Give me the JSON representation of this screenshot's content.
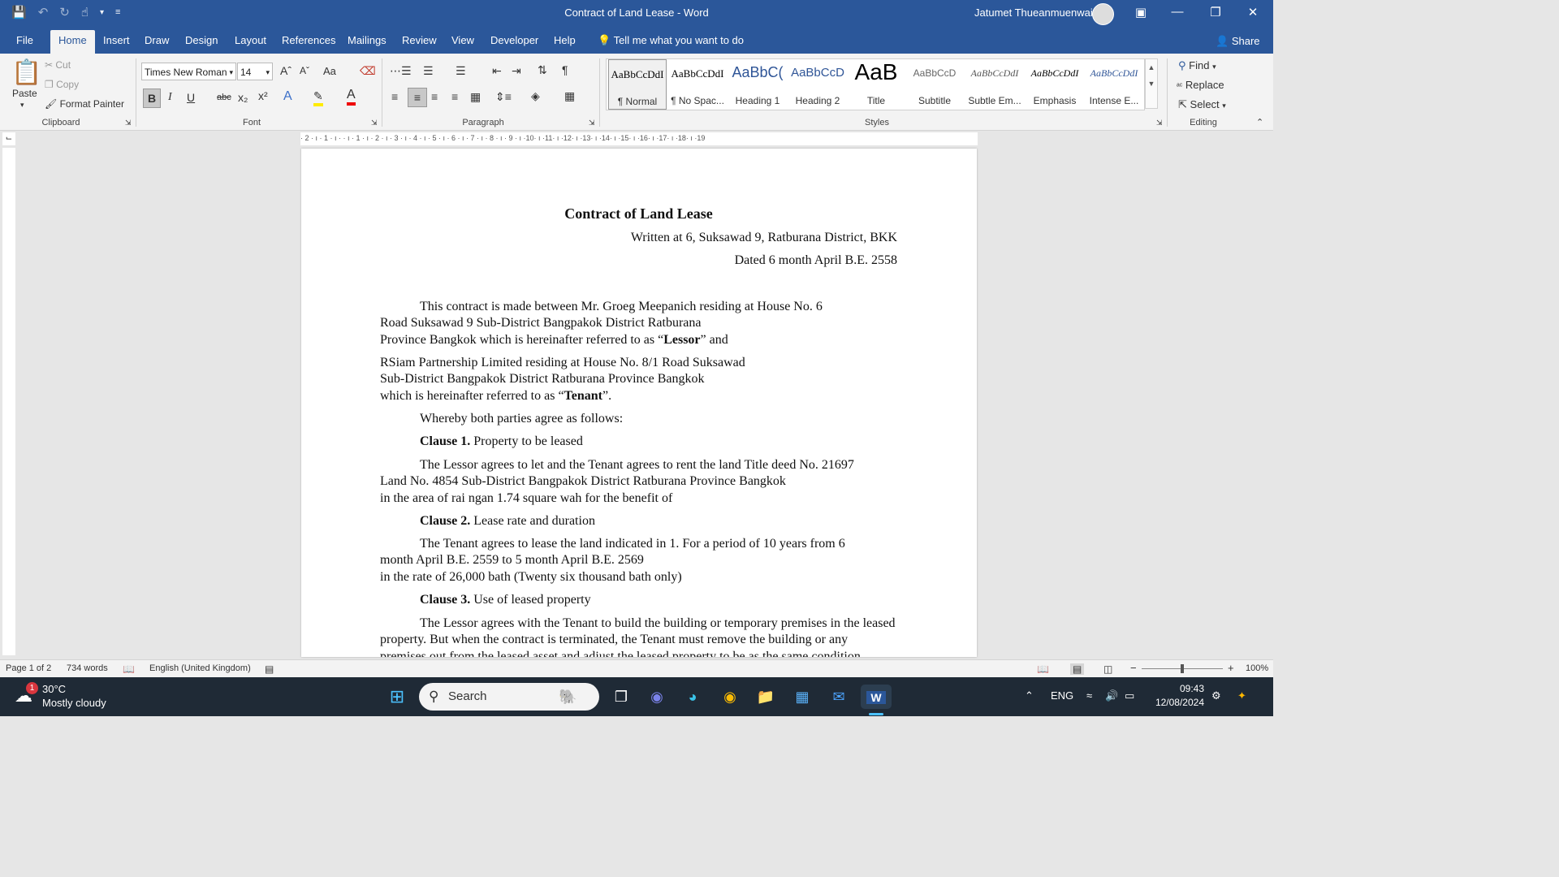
{
  "titlebar": {
    "title": "Contract of Land Lease  -  Word",
    "user": "Jatumet Thueanmuenwai",
    "qat": [
      "save-icon",
      "undo-icon",
      "redo-icon",
      "touch-mode-icon",
      "customize-icon"
    ]
  },
  "menu": {
    "file": "File",
    "tabs": [
      "Home",
      "Insert",
      "Draw",
      "Design",
      "Layout",
      "References",
      "Mailings",
      "Review",
      "View",
      "Developer",
      "Help"
    ],
    "tellme": "Tell me what you want to do",
    "share": "Share"
  },
  "ribbon": {
    "clipboard": {
      "label": "Clipboard",
      "paste": "Paste",
      "cut": "Cut",
      "copy": "Copy",
      "format_painter": "Format Painter"
    },
    "font": {
      "label": "Font",
      "name": "Times New Roman",
      "size": "14",
      "change_case": "Aa",
      "strike": "abc"
    },
    "paragraph": {
      "label": "Paragraph"
    },
    "styles": {
      "label": "Styles",
      "items": [
        {
          "sample": "AaBbCcDdI",
          "name": "¶ Normal"
        },
        {
          "sample": "AaBbCcDdI",
          "name": "¶ No Spac..."
        },
        {
          "sample": "AaBbC(",
          "name": "Heading 1"
        },
        {
          "sample": "AaBbCcD",
          "name": "Heading 2"
        },
        {
          "sample": "AaB",
          "name": "Title"
        },
        {
          "sample": "AaBbCcD",
          "name": "Subtitle"
        },
        {
          "sample": "AaBbCcDdI",
          "name": "Subtle Em..."
        },
        {
          "sample": "AaBbCcDdI",
          "name": "Emphasis"
        },
        {
          "sample": "AaBbCcDdI",
          "name": "Intense E..."
        }
      ]
    },
    "editing": {
      "label": "Editing",
      "find": "Find",
      "replace": "Replace",
      "select": "Select"
    }
  },
  "ruler": "· 2 · ı · 1 · ı ·   · ı · 1 · ı · 2 · ı · 3 · ı · 4 · ı · 5 · ı · 6 · ı · 7 · ı · 8 · ı · 9 · ı ·10· ı ·11· ı ·12· ı ·13· ı ·14· ı ·15· ı ·16· ı ·17· ı ·18· ı ·19",
  "document": {
    "title": "Contract of Land Lease",
    "written_at": "Written at 6, Suksawad 9, Ratburana District, BKK",
    "dated": "Dated  6   month   April         B.E. 2558",
    "p1_l1": "This contract is made between     Mr. Groeg  Meepanich        residing at House No.  6",
    "p1_l2": "Road   Suksawad 9    Sub-District    Bangpakok                 District            Ratburana",
    "p1_l3": "Province          Bangkok          which is hereinafter referred to as “",
    "p1_l3b": "Lessor",
    "p1_l3c": "” and",
    "p2_l1": "RSiam Partnership Limited                 residing at House No.  8/1                 Road  Suksawad",
    "p2_l2": "Sub-District    Bangpakok     District             Ratburana       Province          Bangkok",
    "p2_l3": "which is hereinafter referred to as “",
    "p2_l3b": "Tenant",
    "p2_l3c": "”.",
    "whereby": "Whereby both parties agree as follows:",
    "clause1_b": "Clause 1.",
    "clause1_t": "  Property to be leased",
    "c1_l1": "The Lessor agrees to let and the Tenant agrees to rent the land Title deed No. 21697",
    "c1_l2": "Land No. 4854     Sub-District   Bangpakok  District    Ratburana   Province          Bangkok",
    "c1_l3": "in the area of              rai                          ngan    1.74 square wah for the benefit of",
    "clause2_b": "Clause 2.",
    "clause2_t": " Lease rate and duration",
    "c2_l1": "The Tenant agrees to lease the land indicated in 1. For a period of   10        years  from 6",
    "c2_l2": "month  April                  B.E.    2559    to         5          month              April   B.E.     2569",
    "c2_l3": "in the rate of                     26,000                bath (Twenty six thousand bath only)",
    "clause3_b": "Clause 3.",
    "clause3_t": " Use of leased property",
    "c3_l1": "The Lessor agrees with the Tenant to build the building or temporary premises in the leased",
    "c3_l2": "property. But when the contract is terminated, the Tenant must remove the building or any",
    "c3_l3": "premises out from the leased asset and adjust the leased property to be as the same condition"
  },
  "status": {
    "page": "Page 1 of 2",
    "words": "734 words",
    "language": "English (United Kingdom)",
    "zoom": "100%"
  },
  "taskbar": {
    "weather_temp": "30°C",
    "weather_desc": "Mostly cloudy",
    "weather_badge": "1",
    "search": "Search",
    "lang": "ENG",
    "time": "09:43",
    "date": "12/08/2024"
  }
}
